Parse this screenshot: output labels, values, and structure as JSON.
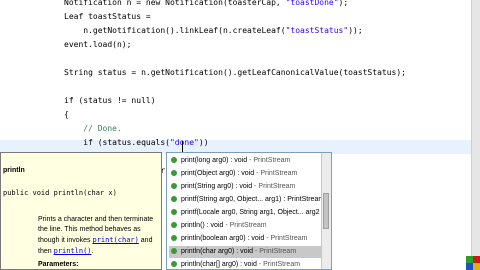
{
  "code": {
    "lines": [
      {
        "pre": "Notification n = new Notification(toasterCap, ",
        "str": "\"toastDone\"",
        "post": ");"
      },
      {
        "pre": "Leaf toastStatus =",
        "str": "",
        "post": ""
      },
      {
        "pre": "    n.getNotification().linkLeaf(n.createLeaf(",
        "str": "\"toastStatus\"",
        "post": "));"
      },
      {
        "pre": "event.load(n);",
        "str": "",
        "post": ""
      },
      {
        "pre": "",
        "str": "",
        "post": ""
      },
      {
        "pre": "String status = n.getNotification().getLeafCanonicalValue(toastStatus);",
        "str": "",
        "post": ""
      },
      {
        "pre": "",
        "str": "",
        "post": ""
      },
      {
        "pre": "if (status != null)",
        "str": "",
        "post": ""
      },
      {
        "pre": "{",
        "str": "",
        "post": ""
      },
      {
        "pre": "    ",
        "cmt": "// Done.",
        "str": "",
        "post": ""
      },
      {
        "pre": "    if (status.equals(",
        "str": "\"done\"",
        "post": "))"
      },
      {
        "pre": "    {",
        "str": "",
        "post": ""
      },
      {
        "pre": "        System.out.pri",
        "str": "",
        "post": ""
      }
    ]
  },
  "javadoc": {
    "title": "println",
    "signature": "public void println(char x)",
    "desc_1": "Prints a character and then terminate the line. This method behaves as though it invokes ",
    "link_1": "print(char)",
    "desc_2": " and then ",
    "link_2": "println()",
    "desc_3": ".",
    "params_heading": "Parameters:"
  },
  "proposals": [
    {
      "sig": "print(long arg0) : void",
      "cls": " - PrintStream",
      "selected": false
    },
    {
      "sig": "print(Object arg0) : void",
      "cls": " - PrintStream",
      "selected": false
    },
    {
      "sig": "print(String arg0) : void",
      "cls": " - PrintStream",
      "selected": false
    },
    {
      "sig": "printf(String arg0, Object... arg1) : PrintStream",
      "cls": "",
      "selected": false
    },
    {
      "sig": "printf(Locale arg0, String arg1, Object... arg2",
      "cls": "",
      "selected": false
    },
    {
      "sig": "println() : void",
      "cls": " - PrintStream",
      "selected": false
    },
    {
      "sig": "println(boolean arg0) : void",
      "cls": " - PrintStream",
      "selected": false
    },
    {
      "sig": "println(char arg0) : void",
      "cls": " - PrintStream",
      "selected": true
    },
    {
      "sig": "println(char[] arg0) : void",
      "cls": " - PrintStream",
      "selected": false
    }
  ],
  "icons": {
    "method": "public-method-icon",
    "corner": "windows-logo-icon"
  },
  "colors": {
    "string": "#2a00ff",
    "keyword": "#7f0055",
    "comment": "#3f7f5f",
    "tooltip_bg": "#ffffe1",
    "selection": "#c8c8c8"
  }
}
